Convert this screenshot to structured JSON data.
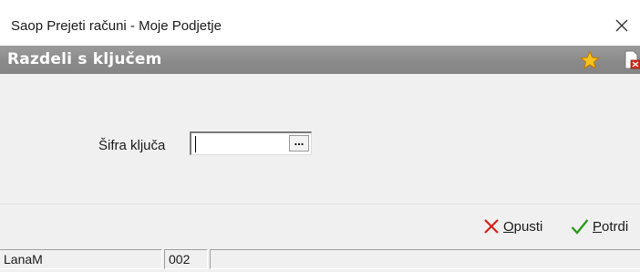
{
  "window": {
    "title": "Saop Prejeti računi - Moje Podjetje",
    "close_icon": "close-icon"
  },
  "header": {
    "title": "Razdeli s ključem",
    "icons": [
      "star-icon",
      "document-delete-icon"
    ]
  },
  "form": {
    "field_label": "Šifra ključa",
    "field_value": "",
    "browse_label": "..."
  },
  "actions": {
    "cancel_mnemonic": "O",
    "cancel_rest": "pusti",
    "confirm_mnemonic": "P",
    "confirm_rest": "otrdi",
    "cancel_color": "#d9201c",
    "confirm_color": "#2f9a1e"
  },
  "status": {
    "user": "LanaM",
    "code": "002",
    "empty": ""
  }
}
